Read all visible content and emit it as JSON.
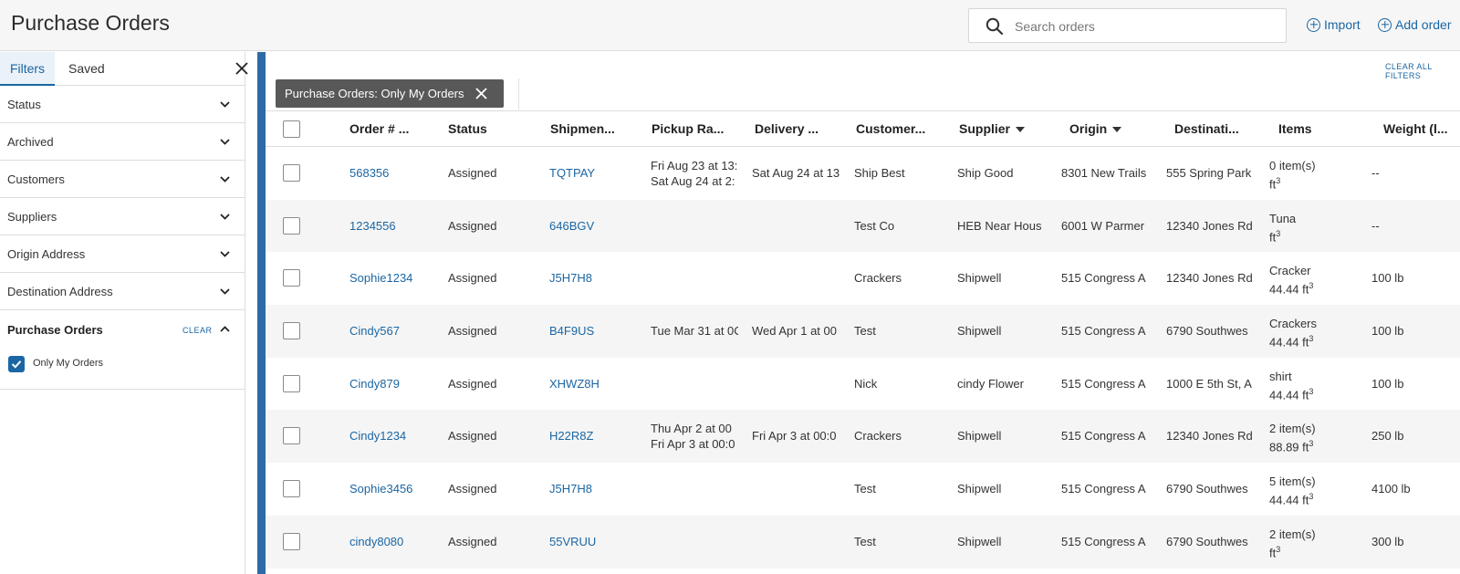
{
  "header": {
    "title": "Purchase Orders",
    "search_placeholder": "Search orders",
    "import_label": "Import",
    "add_order_label": "Add order"
  },
  "sidebar": {
    "tabs": [
      "Filters",
      "Saved"
    ],
    "filters": [
      "Status",
      "Archived",
      "Customers",
      "Suppliers",
      "Origin Address",
      "Destination Address"
    ],
    "purchase_orders": {
      "label": "Purchase Orders",
      "clear_label": "CLEAR",
      "option_label": "Only My Orders",
      "option_checked": true
    }
  },
  "main": {
    "clear_all_label": "CLEAR ALL FILTERS",
    "chip_label": "Purchase Orders: Only My Orders"
  },
  "table": {
    "columns": [
      "Order # ...",
      "Status",
      "Shipmen...",
      "Pickup Ra...",
      "Delivery ...",
      "Customer...",
      "Supplier",
      "Origin",
      "Destinati...",
      "Items",
      "Weight (l..."
    ],
    "rows": [
      {
        "order": "568356",
        "status": "Assigned",
        "shipment": "TQTPAY",
        "pickup1": "Fri Aug 23 at 13:",
        "pickup2": "Sat Aug 24 at 2:",
        "delivery": "Sat Aug 24 at 13",
        "customer": "Ship Best",
        "supplier": "Ship Good",
        "origin": "8301 New Trails",
        "destination": "555 Spring Park",
        "items1": "0 item(s)",
        "items2": "ft",
        "weight": "--"
      },
      {
        "order": "1234556",
        "status": "Assigned",
        "shipment": "646BGV",
        "pickup1": "",
        "pickup2": "",
        "delivery": "",
        "customer": "Test Co",
        "supplier": "HEB Near Hous",
        "origin": "6001 W Parmer",
        "destination": "12340 Jones Rd",
        "items1": "Tuna",
        "items2": "ft",
        "weight": "--"
      },
      {
        "order": "Sophie1234",
        "status": "Assigned",
        "shipment": "J5H7H8",
        "pickup1": "",
        "pickup2": "",
        "delivery": "",
        "customer": "Crackers",
        "supplier": "Shipwell",
        "origin": "515 Congress A",
        "destination": "12340 Jones Rd",
        "items1": "Cracker",
        "items2": "44.44 ft",
        "weight": "100 lb"
      },
      {
        "order": "Cindy567",
        "status": "Assigned",
        "shipment": "B4F9US",
        "pickup1": "Tue Mar 31 at 0C",
        "pickup2": "",
        "delivery": "Wed Apr 1 at 00",
        "customer": "Test",
        "supplier": "Shipwell",
        "origin": "515 Congress A",
        "destination": "6790 Southwes",
        "items1": "Crackers",
        "items2": "44.44 ft",
        "weight": "100 lb"
      },
      {
        "order": "Cindy879",
        "status": "Assigned",
        "shipment": "XHWZ8H",
        "pickup1": "",
        "pickup2": "",
        "delivery": "",
        "customer": "Nick",
        "supplier": "cindy Flower",
        "origin": "515 Congress A",
        "destination": "1000 E 5th St, A",
        "items1": "shirt",
        "items2": "44.44 ft",
        "weight": "100 lb"
      },
      {
        "order": "Cindy1234",
        "status": "Assigned",
        "shipment": "H22R8Z",
        "pickup1": "Thu Apr 2 at 00",
        "pickup2": "Fri Apr 3 at 00:0",
        "delivery": "Fri Apr 3 at 00:0",
        "customer": "Crackers",
        "supplier": "Shipwell",
        "origin": "515 Congress A",
        "destination": "12340 Jones Rd",
        "items1": "2 item(s)",
        "items2": "88.89 ft",
        "weight": "250 lb"
      },
      {
        "order": "Sophie3456",
        "status": "Assigned",
        "shipment": "J5H7H8",
        "pickup1": "",
        "pickup2": "",
        "delivery": "",
        "customer": "Test",
        "supplier": "Shipwell",
        "origin": "515 Congress A",
        "destination": "6790 Southwes",
        "items1": "5 item(s)",
        "items2": "44.44 ft",
        "weight": "4100 lb"
      },
      {
        "order": "cindy8080",
        "status": "Assigned",
        "shipment": "55VRUU",
        "pickup1": "",
        "pickup2": "",
        "delivery": "",
        "customer": "Test",
        "supplier": "Shipwell",
        "origin": "515 Congress A",
        "destination": "6790 Southwes",
        "items1": "2 item(s)",
        "items2": "ft",
        "weight": "300 lb"
      }
    ]
  }
}
